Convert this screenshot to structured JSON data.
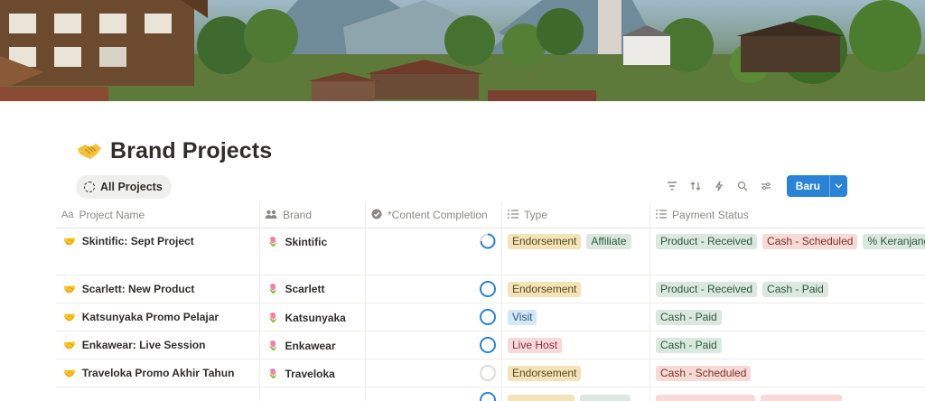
{
  "page": {
    "title": "Brand Projects",
    "title_icon": "handshake-icon",
    "view_tab": "All Projects",
    "new_button": "Baru"
  },
  "columns": [
    {
      "label": "Project Name",
      "icon": "Aa"
    },
    {
      "label": "Brand",
      "icon": "people-icon"
    },
    {
      "label": "*Content Completion",
      "icon": "check-circle-icon"
    },
    {
      "label": "Type",
      "icon": "list-icon"
    },
    {
      "label": "Payment Status",
      "icon": "list-icon"
    }
  ],
  "rows": [
    {
      "name": "Skintific: Sept Project",
      "brand": "Skintific",
      "completion": 0.75,
      "type": [
        "Endorsement",
        "Affiliate"
      ],
      "payment": [
        "Product - Received",
        "Cash - Scheduled",
        "% Keranjang Ku"
      ]
    },
    {
      "name": "Scarlett: New Product",
      "brand": "Scarlett",
      "completion": 1,
      "type": [
        "Endorsement"
      ],
      "payment": [
        "Product - Received",
        "Cash - Paid"
      ]
    },
    {
      "name": "Katsunyaka Promo Pelajar",
      "brand": "Katsunyaka",
      "completion": 1,
      "type": [
        "Visit"
      ],
      "payment": [
        "Cash - Paid"
      ]
    },
    {
      "name": "Enkawear: Live Session",
      "brand": "Enkawear",
      "completion": 1,
      "type": [
        "Live Host"
      ],
      "payment": [
        "Cash - Paid"
      ]
    },
    {
      "name": "Traveloka Promo Akhir Tahun",
      "brand": "Traveloka",
      "completion": 0,
      "type": [
        "Endorsement"
      ],
      "payment": [
        "Cash - Scheduled"
      ]
    }
  ],
  "colors": {
    "accent": "#2a83d6",
    "tag_yellow": "#f2e4b8",
    "tag_green": "#dbe8df",
    "tag_blue": "#d5e6f5",
    "tag_pink": "#f7d9dc",
    "tag_red": "#f7d9d5"
  }
}
